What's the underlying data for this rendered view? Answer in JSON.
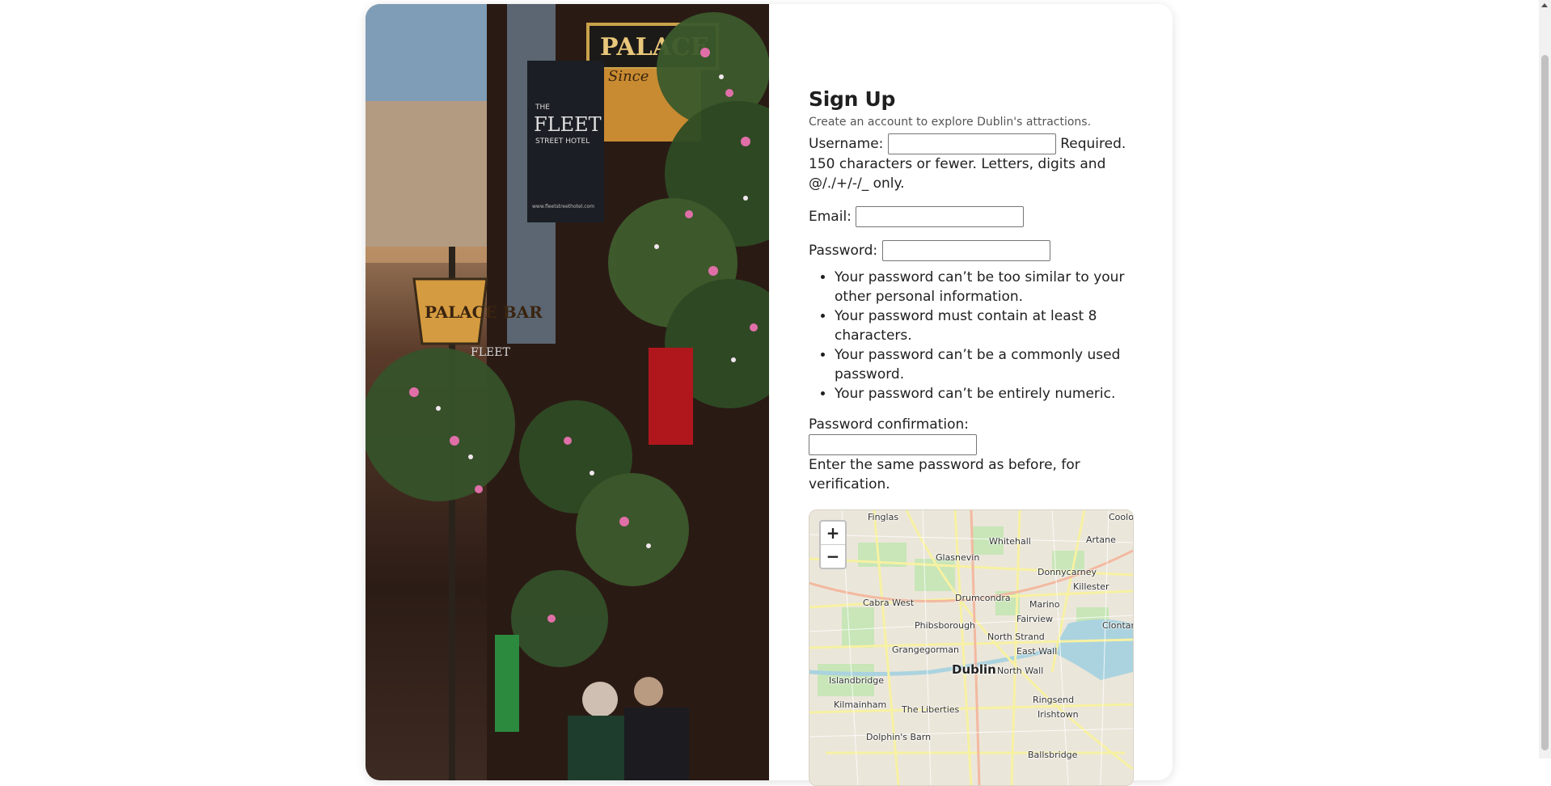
{
  "photo": {
    "signs": [
      "PALACE",
      "Since",
      "THE",
      "FLEET",
      "STREET HOTEL",
      "www.fleetstreethotel.com",
      "PALACE BAR",
      "FLEET"
    ]
  },
  "form": {
    "title": "Sign Up",
    "subtitle": "Create an account to explore Dublin's attractions.",
    "username_label": "Username:",
    "username_help": "Required. 150 characters or fewer. Letters, digits and @/./+/-/_ only.",
    "email_label": "Email:",
    "password_label": "Password:",
    "password_rules": [
      "Your password can’t be too similar to your other personal information.",
      "Your password must contain at least 8 characters.",
      "Your password can’t be a commonly used password.",
      "Your password can’t be entirely numeric."
    ],
    "password2_label": "Password confirmation:",
    "password2_help": "Enter the same password as before, for verification."
  },
  "map": {
    "zoom_in": "+",
    "zoom_out": "−",
    "labels": [
      "Finglas",
      "Coolock",
      "Whitehall",
      "Artane",
      "Glasnevin",
      "Donnycarney",
      "Killester",
      "Cabra West",
      "Drumcondra",
      "Marino",
      "Fairview",
      "Clontarf",
      "Phibsborough",
      "North Strand",
      "Grangegorman",
      "East Wall",
      "Dublin",
      "North Wall",
      "Islandbridge",
      "Kilmainham",
      "The Liberties",
      "Ringsend",
      "Irishtown",
      "Dolphin's Barn",
      "Ballsbridge"
    ]
  },
  "colors": {
    "accent": "#1f1f1f",
    "map_water": "#aad3df",
    "map_road": "#f7f1a2"
  }
}
